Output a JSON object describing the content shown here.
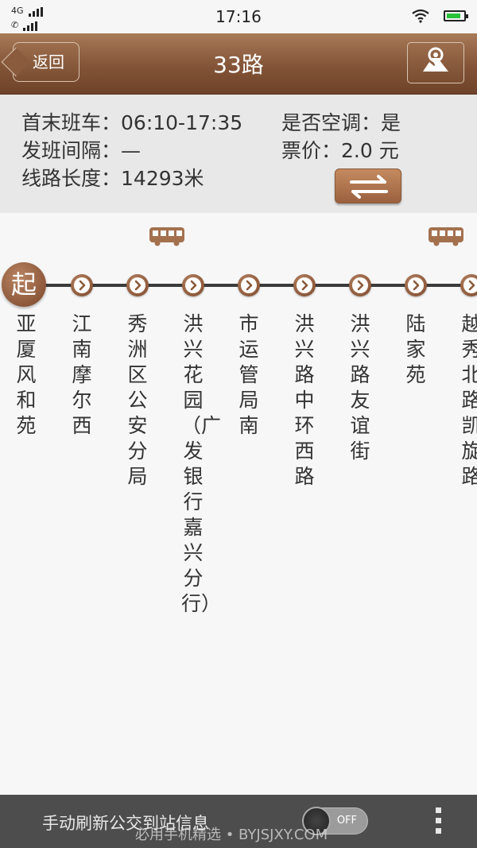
{
  "status_bar": {
    "network": "4G",
    "time": "17:16",
    "battery_level": 0.85,
    "battery_color": "#27c23a"
  },
  "header": {
    "back_label": "返回",
    "title": "33路",
    "map_icon": "map-pin-icon"
  },
  "info": {
    "first_last_label": "首末班车：",
    "first_last_value": "06:10-17:35",
    "aircon_label": "是否空调：",
    "aircon_value": "是",
    "interval_label": "发班间隔：",
    "interval_value": "—",
    "fare_label": "票价：",
    "fare_value": "2.0 元",
    "length_label": "线路长度：",
    "length_value": "14293米"
  },
  "route": {
    "start_badge": "起",
    "stops": [
      "亚厦风和苑",
      "江南摩尔西",
      "秀洲区公安分局",
      "洪兴花园（广发银行嘉兴分行）",
      "市运管局南",
      "洪兴路中环西路",
      "洪兴路友谊街",
      "陆家苑",
      "越秀北路凯旋路"
    ]
  },
  "bottom_bar": {
    "refresh_label": "手动刷新公交到站信息",
    "toggle_state": "OFF",
    "watermark": "必用手机精选 • BYJSJXY.COM"
  },
  "colors": {
    "brand_brown": "#835437",
    "line": "#3b3b3b"
  }
}
